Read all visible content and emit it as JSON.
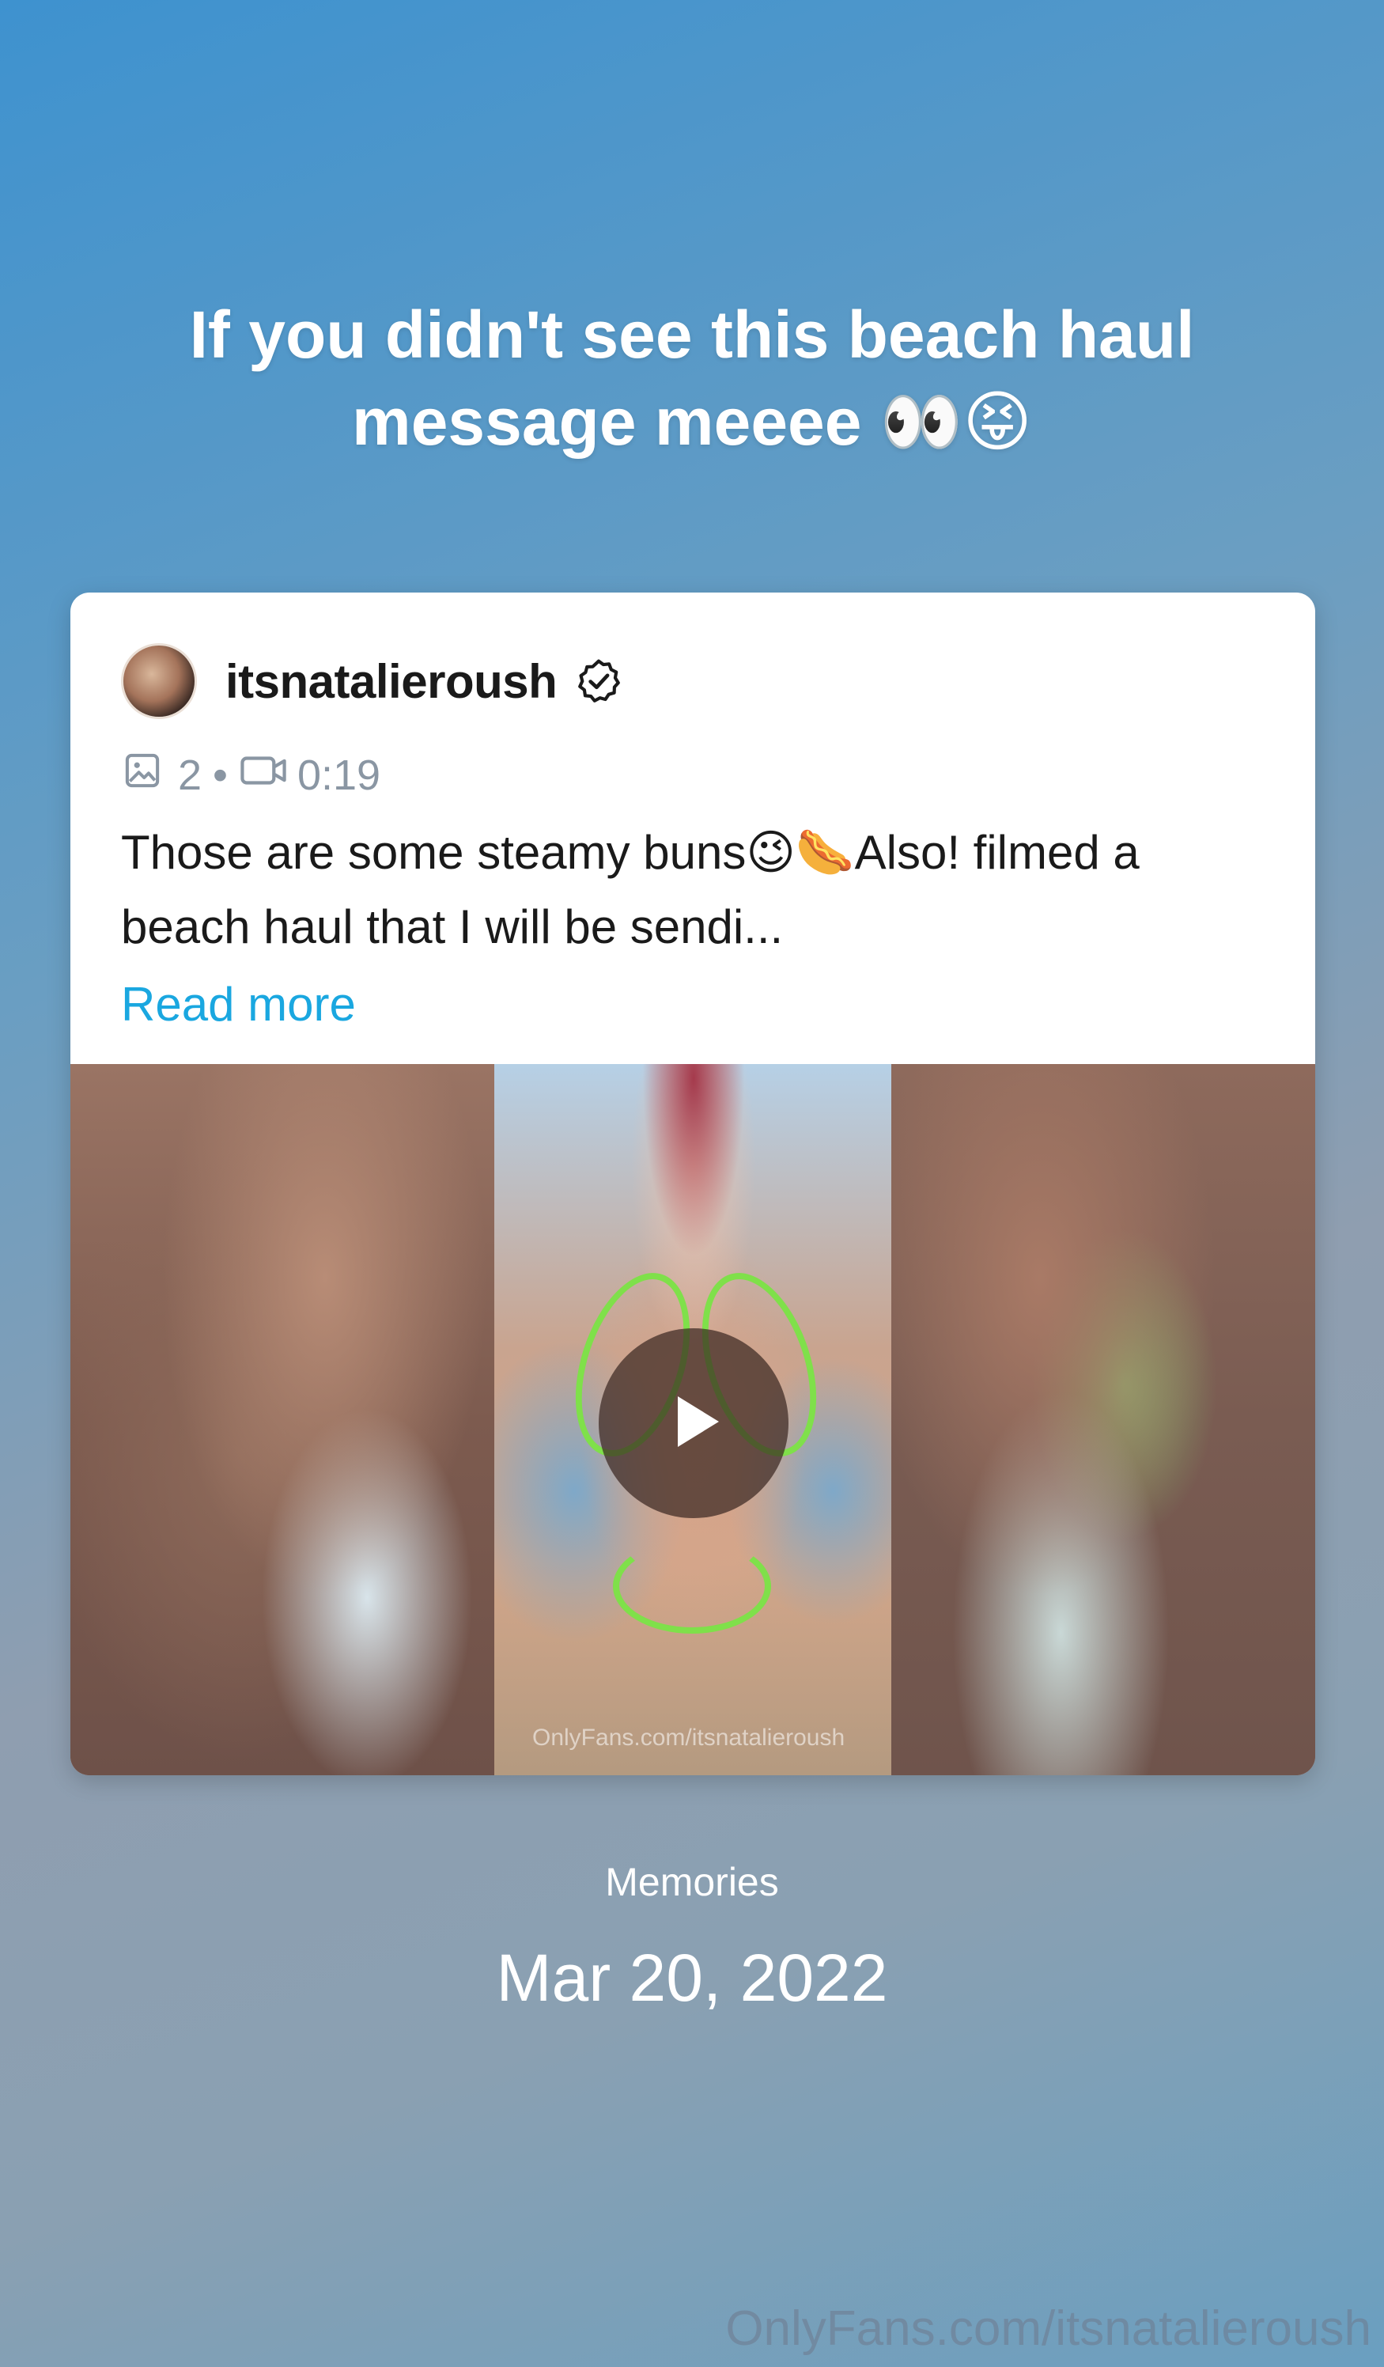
{
  "story": {
    "caption": "If you didn't see this beach haul message meeee 👀😝"
  },
  "post": {
    "username": "itsnatalieroush",
    "verified": true,
    "media_count": "2",
    "meta_separator": "•",
    "video_duration": "0:19",
    "text": "Those are some steamy buns😉🌭Also! filmed a beach haul that I will be sendi...",
    "read_more_label": "Read more",
    "video_watermark": "OnlyFans.com/itsnatalieroush",
    "icons": {
      "avatar": "avatar",
      "verified": "verified-badge-icon",
      "image": "image-icon",
      "video": "video-camera-icon",
      "play": "play-icon"
    }
  },
  "memories": {
    "label": "Memories",
    "date": "Mar 20, 2022"
  },
  "watermark": "OnlyFans.com/itsnatalieroush",
  "colors": {
    "accent_link": "#1aa7e0",
    "meta_gray": "#8a96a3"
  }
}
